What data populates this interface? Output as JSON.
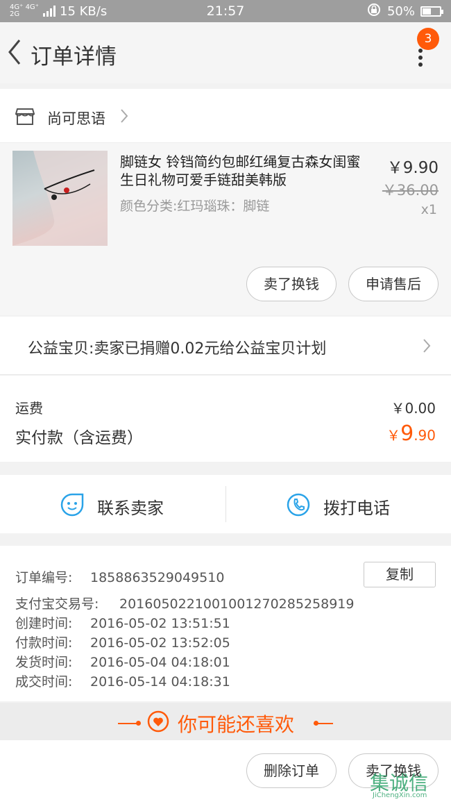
{
  "status_bar": {
    "network": "4G⁺ 4G⁺ 2G",
    "speed": "15 KB/s",
    "time": "21:57",
    "battery": "50%",
    "battery_level": 0.5
  },
  "header": {
    "title": "订单详情",
    "badge": "3"
  },
  "shop": {
    "name": "尚可思语"
  },
  "item": {
    "title": "脚链女 铃铛简约包邮红绳复古森女闺蜜生日礼物可爱手链甜美韩版",
    "sku": "颜色分类:红玛瑙珠：脚链",
    "price": "￥9.90",
    "original_price": "￥36.00",
    "quantity": "x1",
    "actions": [
      "卖了换钱",
      "申请售后"
    ]
  },
  "charity": {
    "text": "公益宝贝:卖家已捐赠0.02元给公益宝贝计划"
  },
  "fees": {
    "shipping_label": "运费",
    "shipping_value": "￥0.00",
    "paid_label": "实付款（含运费）",
    "paid_currency": "￥",
    "paid_int": "9",
    "paid_dec": ".90"
  },
  "contact": {
    "seller": "联系卖家",
    "call": "拨打电话"
  },
  "order_info": {
    "copy_label": "复制",
    "rows": [
      {
        "label": "订单编号:",
        "value": "1858863529049510"
      },
      {
        "label": "支付宝交易号:",
        "value": "2016050221001001270285258919"
      },
      {
        "label": "创建时间:",
        "value": "2016-05-02 13:51:51"
      },
      {
        "label": "付款时间:",
        "value": "2016-05-02 13:52:05"
      },
      {
        "label": "发货时间:",
        "value": "2016-05-04 04:18:01"
      },
      {
        "label": "成交时间:",
        "value": "2016-05-14 04:18:31"
      }
    ]
  },
  "recommend": {
    "title": "你可能还喜欢"
  },
  "bottom_actions": [
    "删除订单",
    "卖了换钱"
  ],
  "watermark": {
    "text": "集诚信",
    "sub": "JiChengXin.com"
  },
  "colors": {
    "accent": "#ff5a0a",
    "icon_blue": "#2aa3e8",
    "status_bar": "#9e9e9e"
  }
}
